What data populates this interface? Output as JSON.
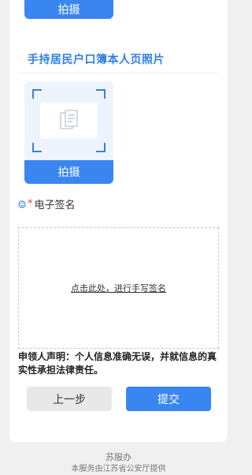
{
  "top_button": {
    "label": "拍摄"
  },
  "section": {
    "title": "手持居民户口簿本人页照片",
    "shoot_label": "拍摄"
  },
  "signature": {
    "required_mark": "*",
    "label": "电子签名",
    "prompt": "点击此处，进行手写签名"
  },
  "declaration": "申领人声明：个人信息准确无误，并就信息的真实性承担法律责任。",
  "actions": {
    "prev_label": "上一步",
    "submit_label": "提交"
  },
  "footer": {
    "title": "苏服办",
    "subtitle": "本服务由江苏省公安厅提供"
  },
  "colors": {
    "accent": "#3a86f0",
    "title": "#2f7fe6",
    "background": "#f0f0f0"
  }
}
